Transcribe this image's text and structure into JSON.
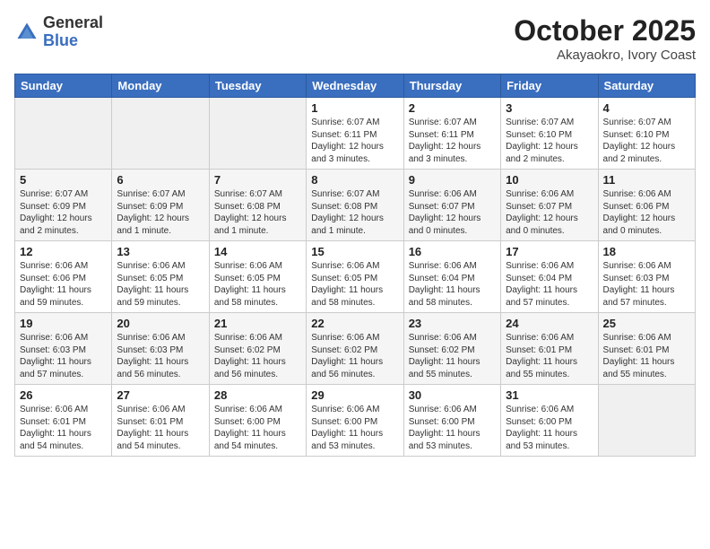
{
  "logo": {
    "general": "General",
    "blue": "Blue"
  },
  "header": {
    "month": "October 2025",
    "location": "Akayaokro, Ivory Coast"
  },
  "weekdays": [
    "Sunday",
    "Monday",
    "Tuesday",
    "Wednesday",
    "Thursday",
    "Friday",
    "Saturday"
  ],
  "weeks": [
    [
      {
        "day": "",
        "sunrise": "",
        "sunset": "",
        "daylight": ""
      },
      {
        "day": "",
        "sunrise": "",
        "sunset": "",
        "daylight": ""
      },
      {
        "day": "",
        "sunrise": "",
        "sunset": "",
        "daylight": ""
      },
      {
        "day": "1",
        "sunrise": "Sunrise: 6:07 AM",
        "sunset": "Sunset: 6:11 PM",
        "daylight": "Daylight: 12 hours and 3 minutes."
      },
      {
        "day": "2",
        "sunrise": "Sunrise: 6:07 AM",
        "sunset": "Sunset: 6:11 PM",
        "daylight": "Daylight: 12 hours and 3 minutes."
      },
      {
        "day": "3",
        "sunrise": "Sunrise: 6:07 AM",
        "sunset": "Sunset: 6:10 PM",
        "daylight": "Daylight: 12 hours and 2 minutes."
      },
      {
        "day": "4",
        "sunrise": "Sunrise: 6:07 AM",
        "sunset": "Sunset: 6:10 PM",
        "daylight": "Daylight: 12 hours and 2 minutes."
      }
    ],
    [
      {
        "day": "5",
        "sunrise": "Sunrise: 6:07 AM",
        "sunset": "Sunset: 6:09 PM",
        "daylight": "Daylight: 12 hours and 2 minutes."
      },
      {
        "day": "6",
        "sunrise": "Sunrise: 6:07 AM",
        "sunset": "Sunset: 6:09 PM",
        "daylight": "Daylight: 12 hours and 1 minute."
      },
      {
        "day": "7",
        "sunrise": "Sunrise: 6:07 AM",
        "sunset": "Sunset: 6:08 PM",
        "daylight": "Daylight: 12 hours and 1 minute."
      },
      {
        "day": "8",
        "sunrise": "Sunrise: 6:07 AM",
        "sunset": "Sunset: 6:08 PM",
        "daylight": "Daylight: 12 hours and 1 minute."
      },
      {
        "day": "9",
        "sunrise": "Sunrise: 6:06 AM",
        "sunset": "Sunset: 6:07 PM",
        "daylight": "Daylight: 12 hours and 0 minutes."
      },
      {
        "day": "10",
        "sunrise": "Sunrise: 6:06 AM",
        "sunset": "Sunset: 6:07 PM",
        "daylight": "Daylight: 12 hours and 0 minutes."
      },
      {
        "day": "11",
        "sunrise": "Sunrise: 6:06 AM",
        "sunset": "Sunset: 6:06 PM",
        "daylight": "Daylight: 12 hours and 0 minutes."
      }
    ],
    [
      {
        "day": "12",
        "sunrise": "Sunrise: 6:06 AM",
        "sunset": "Sunset: 6:06 PM",
        "daylight": "Daylight: 11 hours and 59 minutes."
      },
      {
        "day": "13",
        "sunrise": "Sunrise: 6:06 AM",
        "sunset": "Sunset: 6:05 PM",
        "daylight": "Daylight: 11 hours and 59 minutes."
      },
      {
        "day": "14",
        "sunrise": "Sunrise: 6:06 AM",
        "sunset": "Sunset: 6:05 PM",
        "daylight": "Daylight: 11 hours and 58 minutes."
      },
      {
        "day": "15",
        "sunrise": "Sunrise: 6:06 AM",
        "sunset": "Sunset: 6:05 PM",
        "daylight": "Daylight: 11 hours and 58 minutes."
      },
      {
        "day": "16",
        "sunrise": "Sunrise: 6:06 AM",
        "sunset": "Sunset: 6:04 PM",
        "daylight": "Daylight: 11 hours and 58 minutes."
      },
      {
        "day": "17",
        "sunrise": "Sunrise: 6:06 AM",
        "sunset": "Sunset: 6:04 PM",
        "daylight": "Daylight: 11 hours and 57 minutes."
      },
      {
        "day": "18",
        "sunrise": "Sunrise: 6:06 AM",
        "sunset": "Sunset: 6:03 PM",
        "daylight": "Daylight: 11 hours and 57 minutes."
      }
    ],
    [
      {
        "day": "19",
        "sunrise": "Sunrise: 6:06 AM",
        "sunset": "Sunset: 6:03 PM",
        "daylight": "Daylight: 11 hours and 57 minutes."
      },
      {
        "day": "20",
        "sunrise": "Sunrise: 6:06 AM",
        "sunset": "Sunset: 6:03 PM",
        "daylight": "Daylight: 11 hours and 56 minutes."
      },
      {
        "day": "21",
        "sunrise": "Sunrise: 6:06 AM",
        "sunset": "Sunset: 6:02 PM",
        "daylight": "Daylight: 11 hours and 56 minutes."
      },
      {
        "day": "22",
        "sunrise": "Sunrise: 6:06 AM",
        "sunset": "Sunset: 6:02 PM",
        "daylight": "Daylight: 11 hours and 56 minutes."
      },
      {
        "day": "23",
        "sunrise": "Sunrise: 6:06 AM",
        "sunset": "Sunset: 6:02 PM",
        "daylight": "Daylight: 11 hours and 55 minutes."
      },
      {
        "day": "24",
        "sunrise": "Sunrise: 6:06 AM",
        "sunset": "Sunset: 6:01 PM",
        "daylight": "Daylight: 11 hours and 55 minutes."
      },
      {
        "day": "25",
        "sunrise": "Sunrise: 6:06 AM",
        "sunset": "Sunset: 6:01 PM",
        "daylight": "Daylight: 11 hours and 55 minutes."
      }
    ],
    [
      {
        "day": "26",
        "sunrise": "Sunrise: 6:06 AM",
        "sunset": "Sunset: 6:01 PM",
        "daylight": "Daylight: 11 hours and 54 minutes."
      },
      {
        "day": "27",
        "sunrise": "Sunrise: 6:06 AM",
        "sunset": "Sunset: 6:01 PM",
        "daylight": "Daylight: 11 hours and 54 minutes."
      },
      {
        "day": "28",
        "sunrise": "Sunrise: 6:06 AM",
        "sunset": "Sunset: 6:00 PM",
        "daylight": "Daylight: 11 hours and 54 minutes."
      },
      {
        "day": "29",
        "sunrise": "Sunrise: 6:06 AM",
        "sunset": "Sunset: 6:00 PM",
        "daylight": "Daylight: 11 hours and 53 minutes."
      },
      {
        "day": "30",
        "sunrise": "Sunrise: 6:06 AM",
        "sunset": "Sunset: 6:00 PM",
        "daylight": "Daylight: 11 hours and 53 minutes."
      },
      {
        "day": "31",
        "sunrise": "Sunrise: 6:06 AM",
        "sunset": "Sunset: 6:00 PM",
        "daylight": "Daylight: 11 hours and 53 minutes."
      },
      {
        "day": "",
        "sunrise": "",
        "sunset": "",
        "daylight": ""
      }
    ]
  ]
}
